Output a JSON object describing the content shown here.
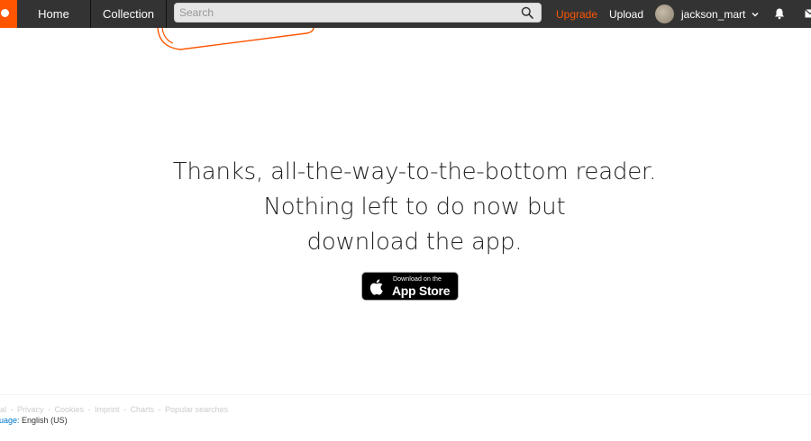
{
  "header": {
    "nav": {
      "home": "Home",
      "collection": "Collection"
    },
    "search": {
      "placeholder": "Search",
      "value": ""
    },
    "upgrade": "Upgrade",
    "upload": "Upload",
    "username": "jackson_mart"
  },
  "main": {
    "message_lines": [
      "Thanks, all-the-way-to-the-bottom reader.",
      "Nothing left to do now but",
      "download the app."
    ],
    "appstore": {
      "small": "Download on the",
      "big": "App Store"
    }
  },
  "footer": {
    "links": [
      "gal",
      "Privacy",
      "Cookies",
      "Imprint",
      "Charts",
      "Popular searches"
    ],
    "language_label": "guage:",
    "language_value": "English (US)"
  },
  "colors": {
    "accent": "#ff5500",
    "topbar": "#333333",
    "link": "#0077cc"
  }
}
